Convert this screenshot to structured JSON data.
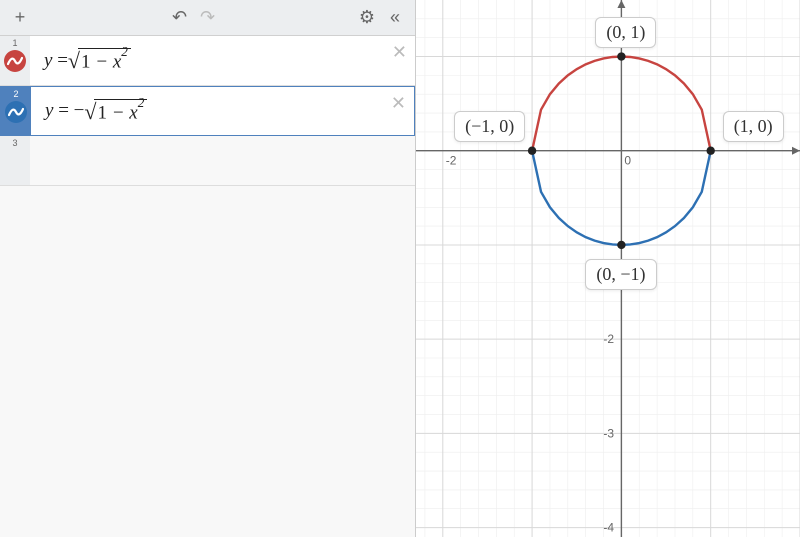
{
  "toolbar": {
    "add_label": "+",
    "undo_label": "↶",
    "redo_label": "↷",
    "settings_label": "⚙",
    "collapse_label": "«"
  },
  "expressions": [
    {
      "index": "1",
      "latex_display": "y = √(1 − x²)",
      "color": "#c74440",
      "selected": false
    },
    {
      "index": "2",
      "latex_display": "y = −√(1 − x²)",
      "color": "#2d70b3",
      "selected": true
    }
  ],
  "empty_row_index": "3",
  "chart_data": {
    "type": "line",
    "title": "",
    "xlabel": "",
    "ylabel": "",
    "xlim": [
      -2.3,
      2.0
    ],
    "ylim": [
      -4.1,
      1.6
    ],
    "xticks": [
      -2,
      -1,
      0,
      1,
      2
    ],
    "yticks": [
      -4,
      -3,
      -2,
      -1,
      1
    ],
    "grid": true,
    "series": [
      {
        "name": "y = √(1 − x²)",
        "color": "#c74440",
        "x": [
          -1.0,
          -0.9,
          -0.8,
          -0.7,
          -0.6,
          -0.5,
          -0.4,
          -0.3,
          -0.2,
          -0.1,
          0.0,
          0.1,
          0.2,
          0.3,
          0.4,
          0.5,
          0.6,
          0.7,
          0.8,
          0.9,
          1.0
        ],
        "y": [
          0.0,
          0.436,
          0.6,
          0.714,
          0.8,
          0.866,
          0.917,
          0.954,
          0.98,
          0.995,
          1.0,
          0.995,
          0.98,
          0.954,
          0.917,
          0.866,
          0.8,
          0.714,
          0.6,
          0.436,
          0.0
        ]
      },
      {
        "name": "y = −√(1 − x²)",
        "color": "#2d70b3",
        "x": [
          -1.0,
          -0.9,
          -0.8,
          -0.7,
          -0.6,
          -0.5,
          -0.4,
          -0.3,
          -0.2,
          -0.1,
          0.0,
          0.1,
          0.2,
          0.3,
          0.4,
          0.5,
          0.6,
          0.7,
          0.8,
          0.9,
          1.0
        ],
        "y": [
          0.0,
          -0.436,
          -0.6,
          -0.714,
          -0.8,
          -0.866,
          -0.917,
          -0.954,
          -0.98,
          -0.995,
          -1.0,
          -0.995,
          -0.98,
          -0.954,
          -0.917,
          -0.866,
          -0.8,
          -0.714,
          -0.6,
          -0.436,
          0.0
        ]
      }
    ],
    "points": [
      {
        "x": 0,
        "y": 1,
        "label": "(0, 1)"
      },
      {
        "x": -1,
        "y": 0,
        "label": "(−1, 0)"
      },
      {
        "x": 1,
        "y": 0,
        "label": "(1, 0)"
      },
      {
        "x": 0,
        "y": -1,
        "label": "(0, −1)"
      }
    ],
    "axis_tick_labels": {
      "x": {
        "-2": "-2",
        "0": "0"
      },
      "y": {
        "-2": "-2",
        "-3": "-3",
        "-4": "-4"
      }
    }
  }
}
